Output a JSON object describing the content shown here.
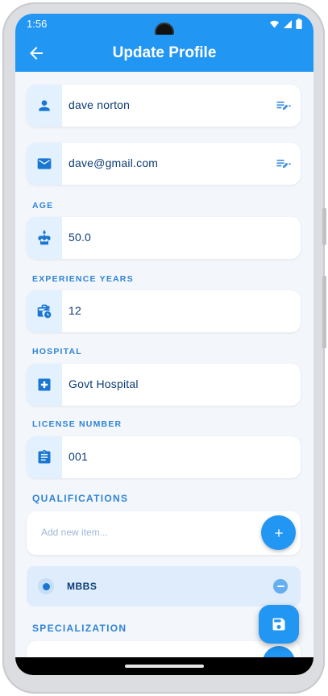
{
  "status_bar": {
    "time": "1:56"
  },
  "app_bar": {
    "title": "Update Profile"
  },
  "fields": {
    "name": "dave norton",
    "email": "dave@gmail.com"
  },
  "age": {
    "label": "AGE",
    "value": "50.0"
  },
  "experience": {
    "label": "EXPERIENCE YEARS",
    "value": "12"
  },
  "hospital": {
    "label": "HOSPITAL",
    "value": "Govt Hospital"
  },
  "license": {
    "label": "LICENSE NUMBER",
    "value": "001"
  },
  "qualifications": {
    "label": "QUALIFICATIONS",
    "placeholder": "Add new item...",
    "items": [
      {
        "label": "MBBS"
      }
    ]
  },
  "specialization": {
    "label": "SPECIALIZATION"
  },
  "colors": {
    "primary": "#2196f3",
    "text": "#0d3c74",
    "section_label": "#2f83d6",
    "background": "#f3f7fc",
    "icon_bg": "#e3f0fd"
  },
  "icons": {
    "back": "arrow-left-icon",
    "name": "person-icon",
    "email": "mail-icon",
    "edit": "edit-note-icon",
    "age": "cake-icon",
    "experience": "work-history-icon",
    "hospital": "medical-cross-icon",
    "license": "clipboard-icon",
    "add": "plus-icon",
    "remove": "minus-icon",
    "save": "save-icon"
  }
}
